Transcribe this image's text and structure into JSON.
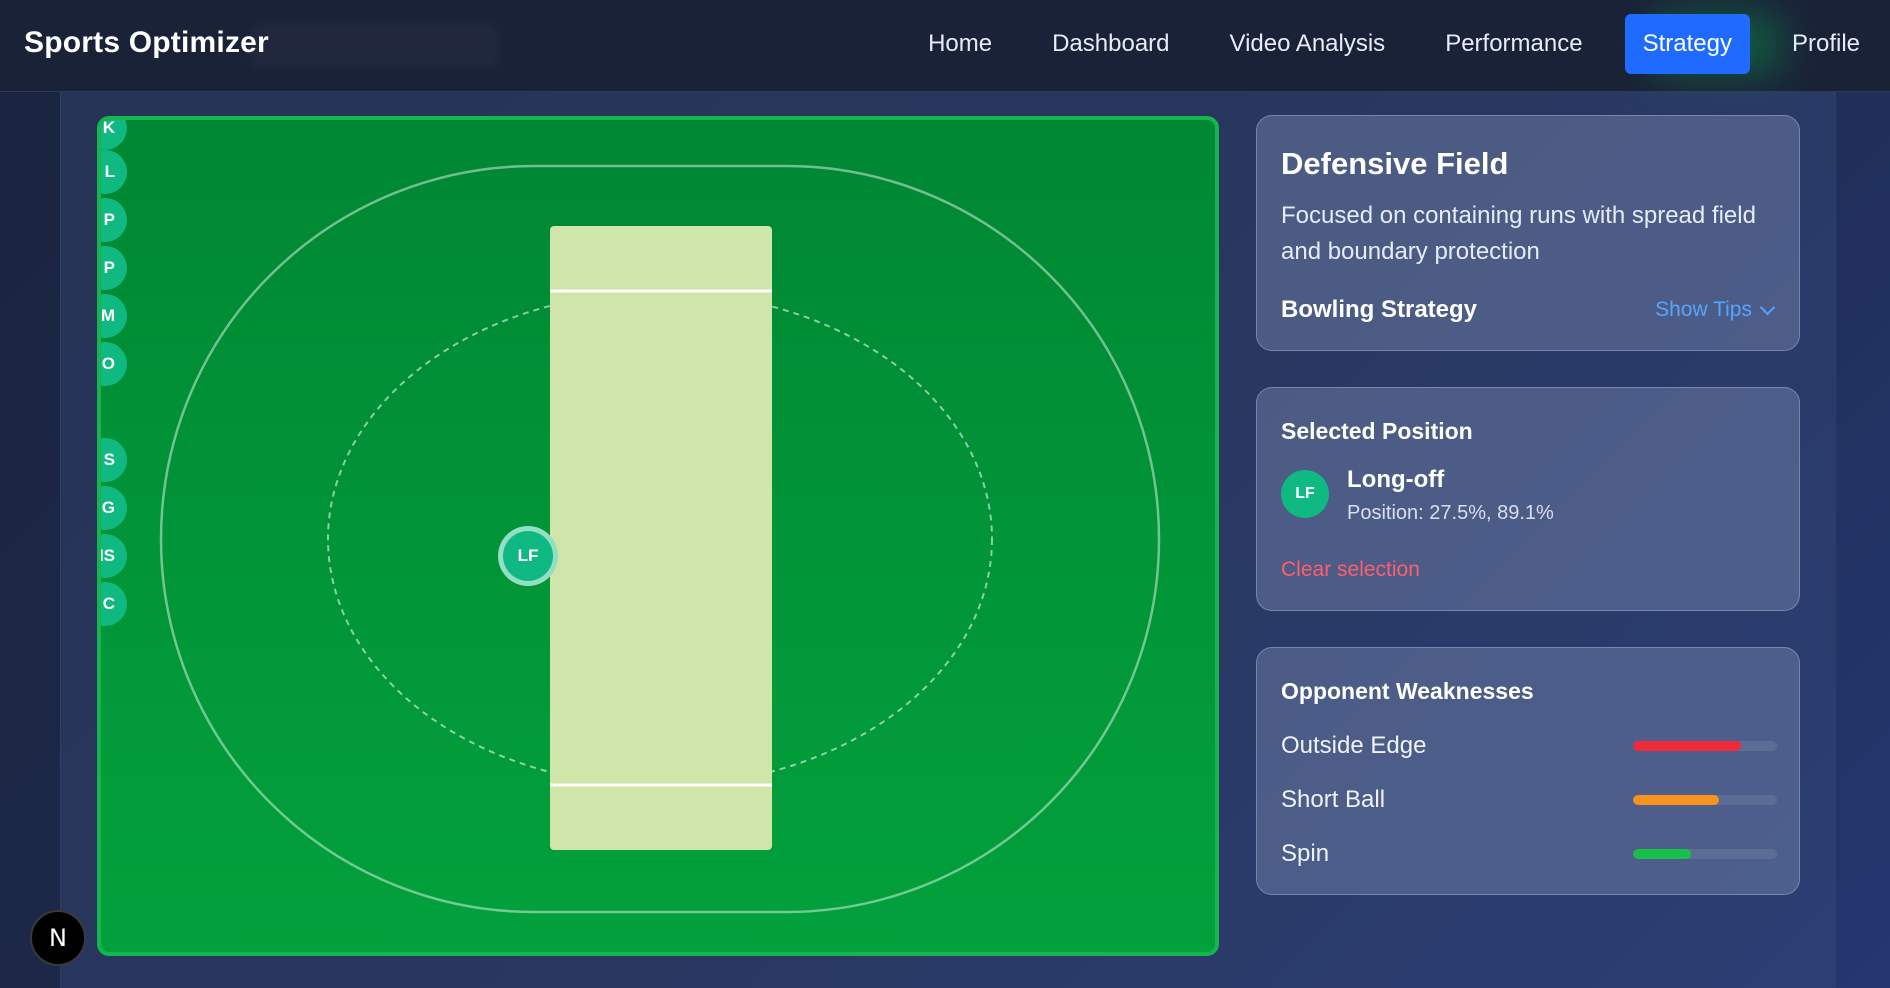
{
  "navbar": {
    "brand": "Sports Optimizer",
    "items": [
      {
        "label": "Home"
      },
      {
        "label": "Dashboard"
      },
      {
        "label": "Video Analysis"
      },
      {
        "label": "Performance"
      },
      {
        "label": "Strategy",
        "active": true
      },
      {
        "label": "Profile"
      }
    ]
  },
  "field": {
    "side_tokens": [
      "K",
      "L",
      "P",
      "P",
      "M",
      "O",
      "S",
      "G",
      "IS",
      "C"
    ],
    "selected_marker": "LF"
  },
  "strategy_panel": {
    "title": "Defensive Field",
    "description": "Focused on containing runs with spread field and boundary protection",
    "subtitle": "Bowling Strategy",
    "tips_link": "Show Tips"
  },
  "selected_position": {
    "title": "Selected Position",
    "badge": "LF",
    "name": "Long-off",
    "position": "Position: 27.5%, 89.1%",
    "clear": "Clear selection"
  },
  "weaknesses": {
    "title": "Opponent Weaknesses",
    "items": [
      {
        "label": "Outside Edge",
        "level": 0.75,
        "color": "#ef2a3a"
      },
      {
        "label": "Short Ball",
        "level": 0.6,
        "color": "#f7941d"
      },
      {
        "label": "Spin",
        "level": 0.4,
        "color": "#18c04a"
      }
    ]
  },
  "dev_badge": "N"
}
